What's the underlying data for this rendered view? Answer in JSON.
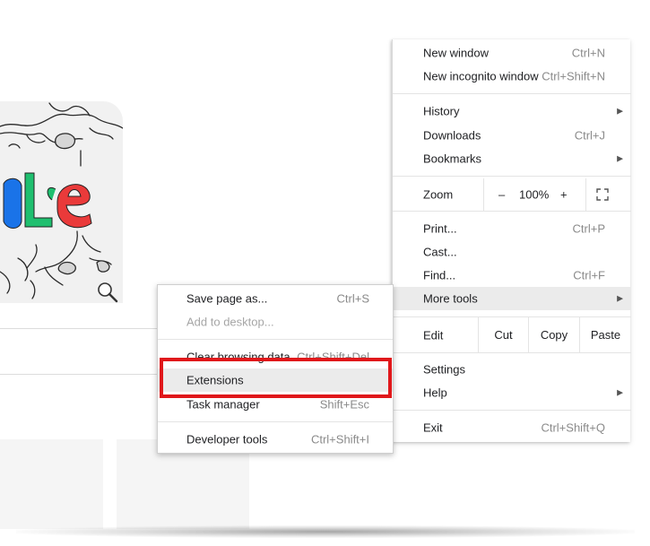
{
  "doodle": {
    "letters": "gle"
  },
  "main_menu": {
    "new_window": {
      "label": "New window",
      "shortcut": "Ctrl+N"
    },
    "new_incognito": {
      "label": "New incognito window",
      "shortcut": "Ctrl+Shift+N"
    },
    "history": {
      "label": "History"
    },
    "downloads": {
      "label": "Downloads",
      "shortcut": "Ctrl+J"
    },
    "bookmarks": {
      "label": "Bookmarks"
    },
    "zoom": {
      "label": "Zoom",
      "minus": "–",
      "level": "100%",
      "plus": "+"
    },
    "print": {
      "label": "Print...",
      "shortcut": "Ctrl+P"
    },
    "cast": {
      "label": "Cast..."
    },
    "find": {
      "label": "Find...",
      "shortcut": "Ctrl+F"
    },
    "more_tools": {
      "label": "More tools"
    },
    "edit": {
      "label": "Edit",
      "cut": "Cut",
      "copy": "Copy",
      "paste": "Paste"
    },
    "settings": {
      "label": "Settings"
    },
    "help": {
      "label": "Help"
    },
    "exit": {
      "label": "Exit",
      "shortcut": "Ctrl+Shift+Q"
    },
    "submenu_arrow": "▶"
  },
  "more_tools_menu": {
    "save_page": {
      "label": "Save page as...",
      "shortcut": "Ctrl+S"
    },
    "add_to_desktop": {
      "label": "Add to desktop..."
    },
    "clear_browsing": {
      "label": "Clear browsing data...",
      "shortcut": "Ctrl+Shift+Del"
    },
    "extensions": {
      "label": "Extensions"
    },
    "task_manager": {
      "label": "Task manager",
      "shortcut": "Shift+Esc"
    },
    "developer_tools": {
      "label": "Developer tools",
      "shortcut": "Ctrl+Shift+I"
    }
  },
  "colors": {
    "highlight": "#e0181b",
    "hover": "#ebebeb",
    "doodle_blue": "#1a73e8",
    "doodle_green": "#1fbf6f",
    "doodle_red": "#ea3a3a"
  }
}
